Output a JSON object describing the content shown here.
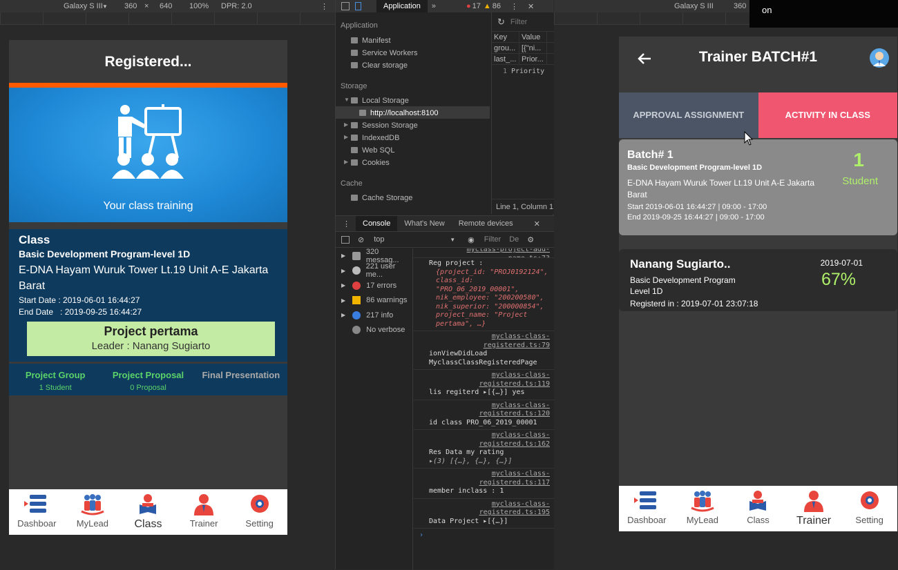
{
  "left_toolbar": {
    "device": "Galaxy S III",
    "width": "360",
    "x": "×",
    "height": "640",
    "zoom": "100%",
    "dpr": "DPR: 2.0"
  },
  "right_toolbar": {
    "device": "Galaxy S III",
    "width": "360"
  },
  "overlay_text": "on",
  "left_phone": {
    "header": "Registered...",
    "hero_caption": "Your class training",
    "class_card": {
      "title": "Class",
      "program": "Basic Development Program-level 1D",
      "location": "E-DNA Hayam Wuruk Tower Lt.19 Unit A-E Jakarta Barat",
      "start": "Start Date : 2019-06-01 16:44:27",
      "end": "End Date   : 2019-09-25 16:44:27"
    },
    "project": {
      "name": "Project pertama",
      "leader": "Leader : Nanang Sugiarto"
    },
    "stats": [
      {
        "label": "Project Group",
        "sub": "1 Student"
      },
      {
        "label": "Project Proposal",
        "sub": "0 Proposal"
      },
      {
        "label": "Final Presentation",
        "sub": ""
      }
    ],
    "tabs": [
      "Dashboar",
      "MyLead",
      "Class",
      "Trainer",
      "Setting"
    ]
  },
  "devtools": {
    "top_tab": "Application",
    "errors": "17",
    "warnings": "86",
    "app_section": "Application",
    "app_items": [
      "Manifest",
      "Service Workers",
      "Clear storage"
    ],
    "storage_section": "Storage",
    "storage_items": [
      "Local Storage",
      "http://localhost:8100",
      "Session Storage",
      "IndexedDB",
      "Web SQL",
      "Cookies"
    ],
    "cache_section": "Cache",
    "cache_items": [
      "Cache Storage"
    ],
    "filter": "Filter",
    "kv_headers": [
      "Key",
      "Value"
    ],
    "kv_rows": [
      [
        "grou...",
        "[{\"ni..."
      ],
      [
        "last_...",
        "Prior..."
      ]
    ],
    "preview_line": "1",
    "preview_text": "Priority",
    "status": "Line 1, Column 1",
    "console_tabs": [
      "Console",
      "What's New",
      "Remote devices"
    ],
    "context": "top",
    "filter2": "Filter",
    "levels": "De",
    "sidebar": [
      {
        "label": "320 messag...",
        "color": "#999"
      },
      {
        "label": "221 user me...",
        "color": "#bbb"
      },
      {
        "label": "17 errors",
        "color": "#e04040"
      },
      {
        "label": "86 warnings",
        "color": "#f0b400"
      },
      {
        "label": "217 info",
        "color": "#3a7de0"
      },
      {
        "label": "No verbose",
        "color": "#888"
      }
    ],
    "log": [
      {
        "link": "myclass-project-add-name.ts:73"
      },
      {
        "text": "Reg project :",
        "obj": "{project_id: \"PROJ0192124\", class_id: \"PRO_06_2019_00001\", nik_employee: \"200200580\", nik_superior: \"200000854\", project_name: \"Project pertama\", …}"
      },
      {
        "link": "myclass-class-registered.ts:79",
        "text": "ionViewDidLoad MyclassClassRegisteredPage"
      },
      {
        "link": "myclass-class-registered.ts:119",
        "text": "lis regiterd ▸[{…}] yes"
      },
      {
        "link": "myclass-class-registered.ts:120",
        "text": "id class PRO_06_2019_00001"
      },
      {
        "link": "myclass-class-registered.ts:162",
        "text": "Res Data my rating",
        "obj": "▸(3) [{…}, {…}, {…}]"
      },
      {
        "link": "myclass-class-registered.ts:117",
        "text": "member inclass : 1"
      },
      {
        "link": "myclass-class-registered.ts:195",
        "text": "Data Project ▸[{…}]"
      }
    ]
  },
  "right_phone": {
    "header": "Trainer BATCH#1",
    "segments": [
      "APPROVAL ASSIGNMENT",
      "ACTIVITY IN CLASS"
    ],
    "batch": {
      "title": "Batch# 1",
      "program": "Basic Development Program-level 1D",
      "location": "E-DNA Hayam Wuruk Tower Lt.19 Unit A-E Jakarta Barat",
      "start": "Start 2019-06-01 16:44:27 | 09:00 - 17:00",
      "end": "End 2019-09-25 16:44:27 | 09:00 - 17:00",
      "count": "1",
      "count_label": "Student"
    },
    "student": {
      "name": "Nanang Sugiarto..",
      "program": "Basic Development Program Level 1D",
      "registered": "Registerd in : 2019-07-01 23:07:18",
      "date": "2019-07-01",
      "progress": "67%"
    },
    "tabs": [
      "Dashboar",
      "MyLead",
      "Class",
      "Trainer",
      "Setting"
    ]
  }
}
